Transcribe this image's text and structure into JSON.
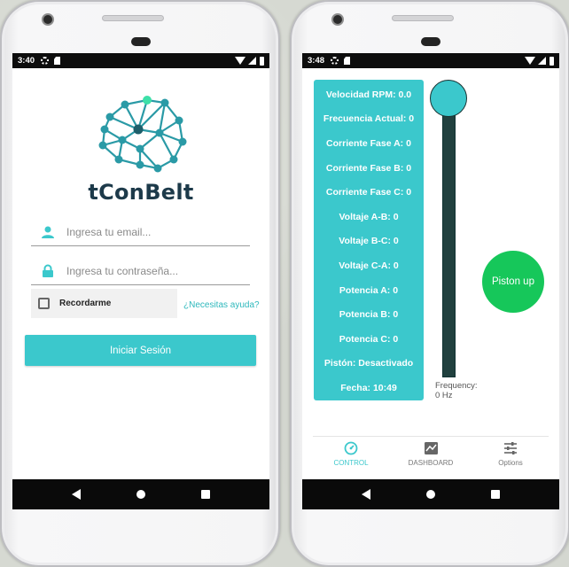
{
  "login": {
    "status_time": "3:40",
    "brand": "tConBelt",
    "email_placeholder": "Ingresa tu email...",
    "password_placeholder": "Ingresa tu contraseña...",
    "remember_label": "Recordarme",
    "help_link": "¿Necesitas ayuda?",
    "login_button": "Iniciar Sesión"
  },
  "control": {
    "status_time": "3:48",
    "readings": [
      "Velocidad RPM: 0.0",
      "Frecuencia Actual: 0",
      "Corriente Fase A: 0",
      "Corriente Fase B: 0",
      "Corriente Fase C: 0",
      "Voltaje A-B: 0",
      "Voltaje B-C: 0",
      "Voltaje C-A: 0",
      "Potencia A: 0",
      "Potencia B: 0",
      "Potencia C: 0",
      "Pistón: Desactivado",
      "Fecha: 10:49"
    ],
    "frequency_label": "Frequency:",
    "frequency_value": "0 Hz",
    "slider_value": 0,
    "piston_button": "Piston up",
    "bottom_nav": [
      {
        "label": "CONTROL",
        "icon": "gauge-icon",
        "active": true
      },
      {
        "label": "DASHBOARD",
        "icon": "chart-icon",
        "active": false
      },
      {
        "label": "Options",
        "icon": "sliders-icon",
        "active": false
      }
    ]
  },
  "colors": {
    "accent": "#3bc8cc",
    "piston_green": "#16c75a",
    "brand_dark": "#1d3a4a"
  }
}
